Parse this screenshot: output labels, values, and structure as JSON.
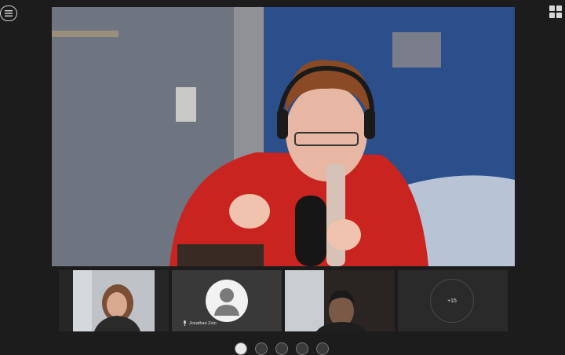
{
  "participants": {
    "tile2_name": "Jonathan Zolo",
    "overflow_count": "+15"
  },
  "icons": {
    "menu": "hamburger-menu-icon",
    "layout": "grid-layout-icon",
    "mic": "microphone-icon",
    "avatar": "person-avatar-icon"
  },
  "colors": {
    "background": "#1c1c1c",
    "tile": "#2b2b2b",
    "avatar_bg": "#f2f2f2"
  }
}
